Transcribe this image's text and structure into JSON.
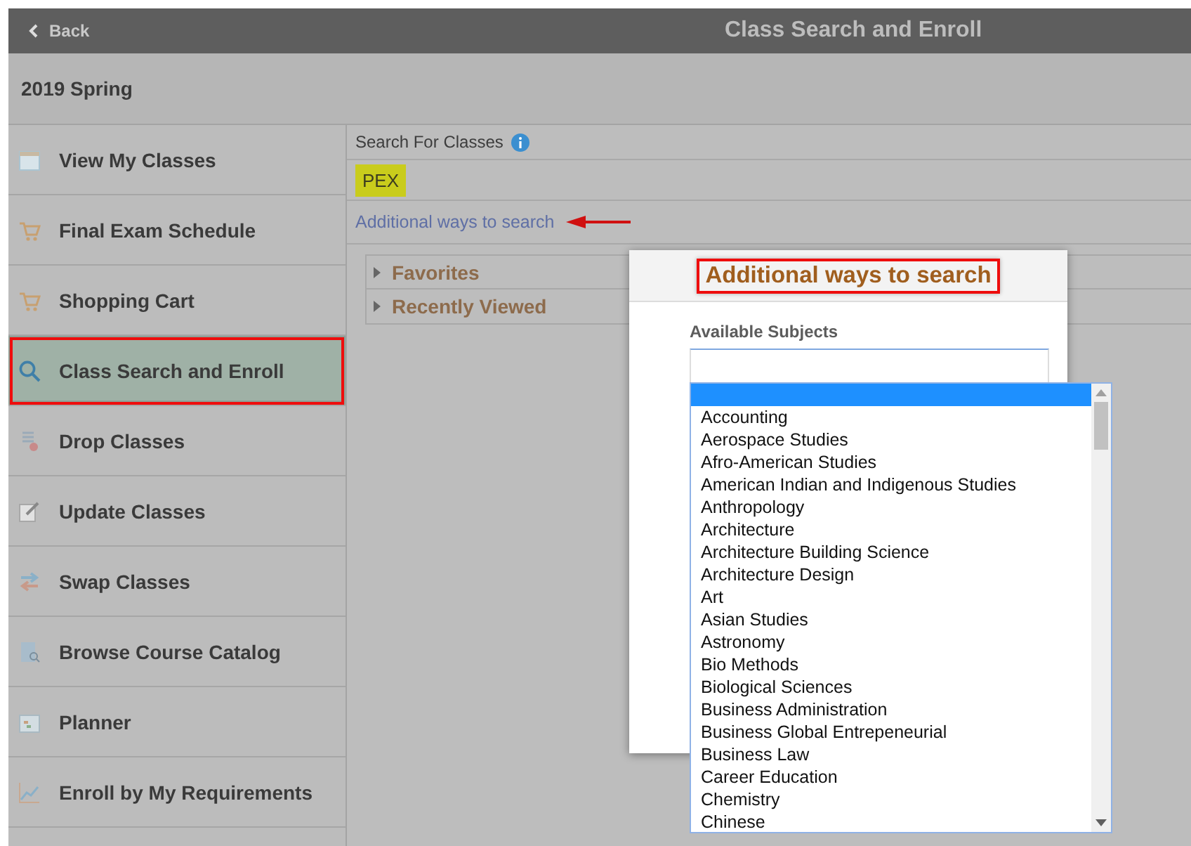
{
  "header": {
    "back": "Back",
    "title": "Class Search and Enroll"
  },
  "term": "2019 Spring",
  "sidebar": {
    "items": [
      {
        "label": "View My Classes",
        "selected": false
      },
      {
        "label": "Final Exam Schedule",
        "selected": false
      },
      {
        "label": "Shopping Cart",
        "selected": false
      },
      {
        "label": "Class Search and Enroll",
        "selected": true
      },
      {
        "label": "Drop Classes",
        "selected": false
      },
      {
        "label": "Update Classes",
        "selected": false
      },
      {
        "label": "Swap Classes",
        "selected": false
      },
      {
        "label": "Browse Course Catalog",
        "selected": false
      },
      {
        "label": "Planner",
        "selected": false
      },
      {
        "label": "Enroll by My Requirements",
        "selected": false
      }
    ]
  },
  "search": {
    "label": "Search For Classes",
    "value": "PEX",
    "link": "Additional ways to search"
  },
  "sections": [
    {
      "label": "Favorites",
      "expanded": false
    },
    {
      "label": "Recently Viewed",
      "expanded": false
    }
  ],
  "dialog": {
    "title": "Additional ways to search",
    "field_label": "Available Subjects",
    "blank_option_selected": true,
    "options": [
      {
        "label": "Accounting",
        "selected": false
      },
      {
        "label": "Aerospace Studies",
        "selected": false
      },
      {
        "label": "Afro-American Studies",
        "selected": false
      },
      {
        "label": "American Indian and Indigenous Studies",
        "selected": false
      },
      {
        "label": "Anthropology",
        "selected": false
      },
      {
        "label": "Architecture",
        "selected": false
      },
      {
        "label": "Architecture Building Science",
        "selected": false
      },
      {
        "label": "Architecture Design",
        "selected": false
      },
      {
        "label": "Art",
        "selected": false
      },
      {
        "label": "Asian Studies",
        "selected": false
      },
      {
        "label": "Astronomy",
        "selected": false
      },
      {
        "label": "Bio Methods",
        "selected": false
      },
      {
        "label": "Biological Sciences",
        "selected": false
      },
      {
        "label": "Business Administration",
        "selected": false
      },
      {
        "label": "Business Global Entrepeneurial",
        "selected": false
      },
      {
        "label": "Business Law",
        "selected": false
      },
      {
        "label": "Career Education",
        "selected": false
      },
      {
        "label": "Chemistry",
        "selected": false
      },
      {
        "label": "Chinese",
        "selected": false
      }
    ]
  }
}
